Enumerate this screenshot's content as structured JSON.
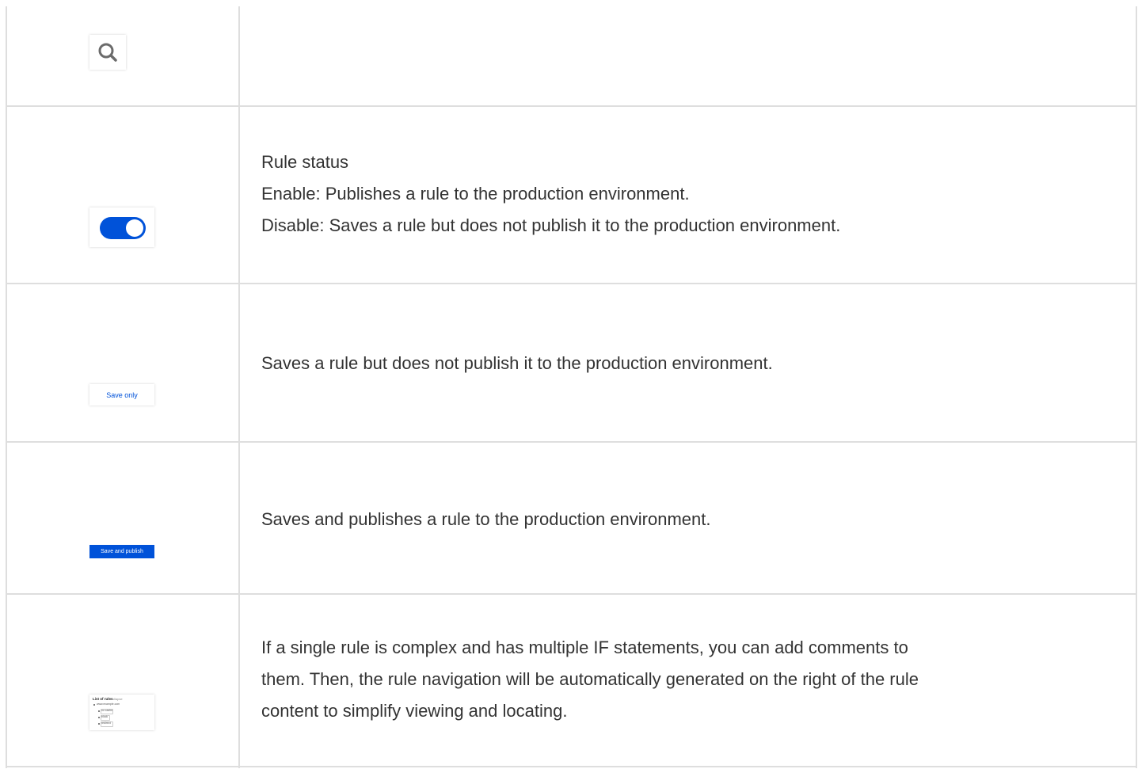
{
  "rows": [
    {
      "icon": "search-icon",
      "lines": []
    },
    {
      "icon": "toggle-switch",
      "toggle_state": "on",
      "lines": [
        "Rule status",
        "Enable: Publishes a rule to the production environment.",
        "Disable: Saves a rule but does not publish it to the production environment."
      ]
    },
    {
      "button_label": "Save only",
      "lines": [
        "Saves a rule but does not publish it to the production environment."
      ]
    },
    {
      "button_label": "Save and publish",
      "lines": [
        "Saves and publishes a rule to the production environment."
      ]
    },
    {
      "icon": "rule-navigation-thumbnail",
      "thumbnail": {
        "title": "List of rules",
        "subtitle": "Collapse",
        "items": [
          "www.example.com",
          "no cache",
          "block",
          "redirect"
        ]
      },
      "lines": [
        "If a single rule is complex and has multiple IF statements, you can add comments to",
        "them. Then, the rule navigation will be automatically generated on the right of the rule",
        "content to simplify viewing and locating."
      ]
    }
  ],
  "colors": {
    "accent": "#0052d9",
    "border": "#dedede",
    "text": "#333333"
  }
}
